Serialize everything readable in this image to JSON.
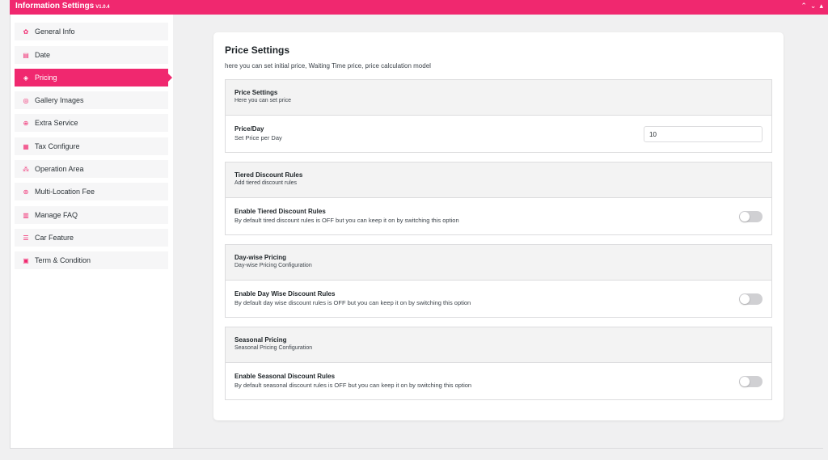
{
  "header": {
    "title": "Information Settings",
    "version": "V1.0.4",
    "controls": [
      "⌃",
      "⌄",
      "▴"
    ]
  },
  "accent_color": "#f0286f",
  "sidebar": {
    "items": [
      {
        "label": "General Info",
        "icon": "gear-icon",
        "active": false
      },
      {
        "label": "Date",
        "icon": "calendar-icon",
        "active": false
      },
      {
        "label": "Pricing",
        "icon": "money-icon",
        "active": true
      },
      {
        "label": "Gallery Images",
        "icon": "images-icon",
        "active": false
      },
      {
        "label": "Extra Service",
        "icon": "gift-icon",
        "active": false
      },
      {
        "label": "Tax Configure",
        "icon": "tax-icon",
        "active": false
      },
      {
        "label": "Operation Area",
        "icon": "route-icon",
        "active": false
      },
      {
        "label": "Multi-Location Fee",
        "icon": "location-icon",
        "active": false
      },
      {
        "label": "Manage FAQ",
        "icon": "faq-icon",
        "active": false
      },
      {
        "label": "Car Feature",
        "icon": "list-icon",
        "active": false
      },
      {
        "label": "Term & Condition",
        "icon": "document-icon",
        "active": false
      }
    ]
  },
  "main": {
    "title": "Price Settings",
    "description": "here you can set initial price, Waiting Time price, price calculation model",
    "sections": [
      {
        "title": "Price Settings",
        "subtitle": "Here you can set price",
        "row": {
          "label": "Price/Day",
          "desc": "Set Price per Day",
          "value": "10"
        }
      },
      {
        "title": "Tiered Discount Rules",
        "subtitle": "Add tiered discount rules",
        "row": {
          "label": "Enable Tiered Discount Rules",
          "desc": "By default tired discount rules is OFF but you can keep it on by switching this option",
          "enabled": false
        }
      },
      {
        "title": "Day-wise Pricing",
        "subtitle": "Day-wise Pricing Configuration",
        "row": {
          "label": "Enable Day Wise Discount Rules",
          "desc": "By default day wise discount rules is OFF but you can keep it on by switching this option",
          "enabled": false
        }
      },
      {
        "title": "Seasonal Pricing",
        "subtitle": "Seasonal Pricing Configuration",
        "row": {
          "label": "Enable Seasonal Discount Rules",
          "desc": "By default seasonal discount rules is OFF but you can keep it on by switching this option",
          "enabled": false
        }
      }
    ]
  }
}
